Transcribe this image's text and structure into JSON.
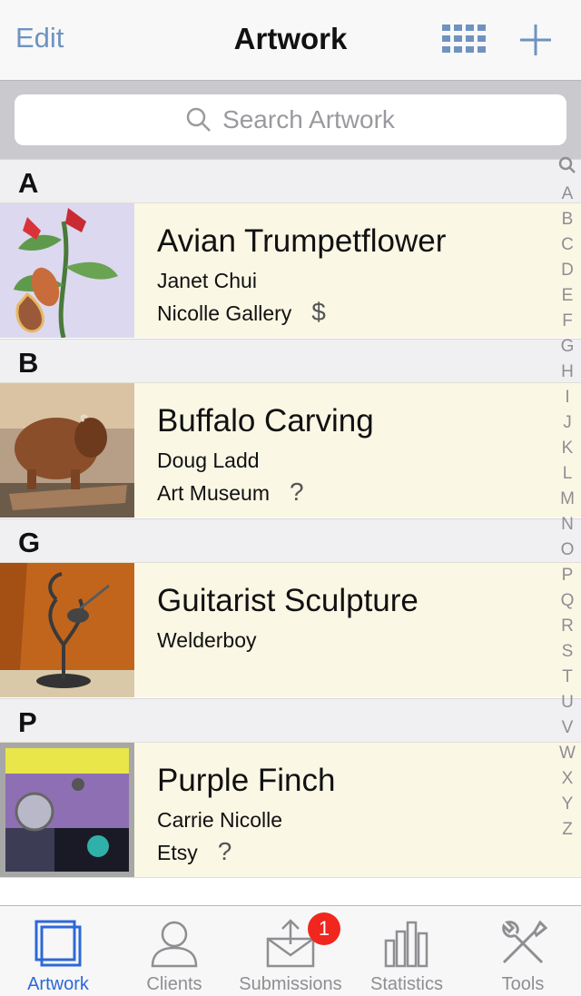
{
  "nav": {
    "edit_label": "Edit",
    "title": "Artwork"
  },
  "search": {
    "placeholder": "Search Artwork"
  },
  "sections": [
    {
      "letter": "A",
      "item": {
        "title": "Avian Trumpetflower",
        "artist": "Janet Chui",
        "location": "Nicolle Gallery",
        "flag": "$"
      }
    },
    {
      "letter": "B",
      "item": {
        "title": "Buffalo Carving",
        "artist": "Doug Ladd",
        "location": "Art Museum",
        "flag": "?"
      }
    },
    {
      "letter": "G",
      "item": {
        "title": "Guitarist Sculpture",
        "artist": "Welderboy",
        "location": "",
        "flag": ""
      }
    },
    {
      "letter": "P",
      "item": {
        "title": "Purple Finch",
        "artist": "Carrie Nicolle",
        "location": "Etsy",
        "flag": "?"
      }
    }
  ],
  "index_letters": [
    "A",
    "B",
    "C",
    "D",
    "E",
    "F",
    "G",
    "H",
    "I",
    "J",
    "K",
    "L",
    "M",
    "N",
    "O",
    "P",
    "Q",
    "R",
    "S",
    "T",
    "U",
    "V",
    "W",
    "X",
    "Y",
    "Z"
  ],
  "tabs": [
    {
      "label": "Artwork",
      "icon": "artwork-icon",
      "active": true
    },
    {
      "label": "Clients",
      "icon": "person-icon"
    },
    {
      "label": "Submissions",
      "icon": "envelope-icon",
      "badge": "1"
    },
    {
      "label": "Statistics",
      "icon": "bar-chart-icon"
    },
    {
      "label": "Tools",
      "icon": "tools-icon"
    }
  ],
  "colors": {
    "accent": "#2d68d8",
    "nav_link": "#6e93c0",
    "row_bg": "#fbf7e5",
    "badge": "#f0261f"
  }
}
